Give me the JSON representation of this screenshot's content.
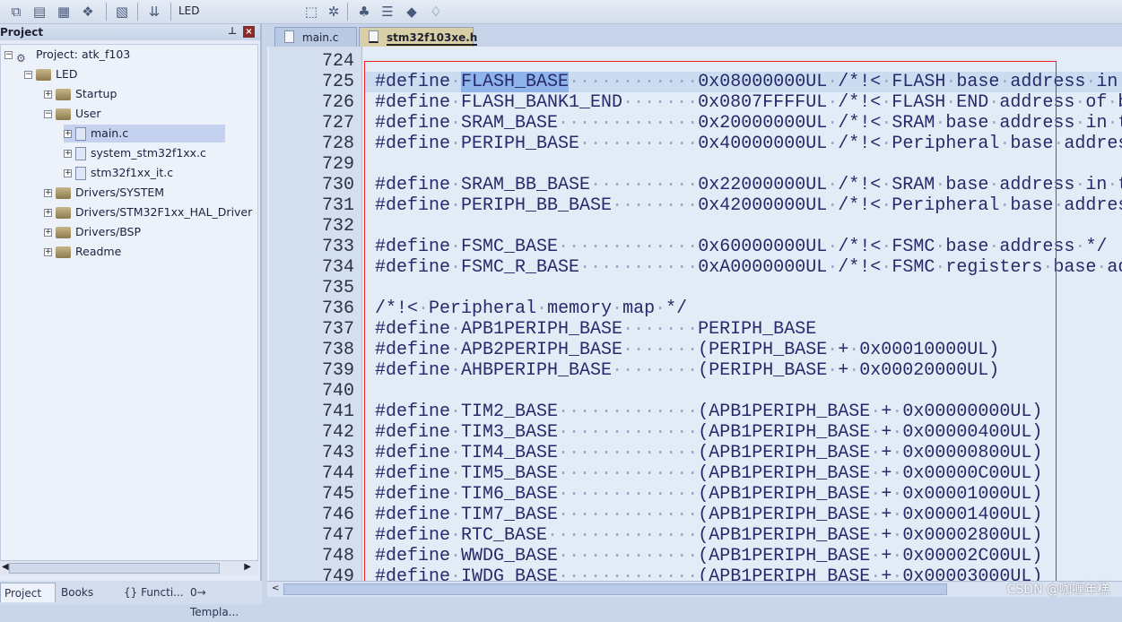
{
  "toolbar": {
    "target": "LED",
    "icons": [
      "translate-icon",
      "build-icon",
      "rebuild-icon",
      "batch-build-icon",
      "stop-build-icon",
      "download-icon",
      "target-options-icon",
      "manage-components-icon",
      "pack-installer-icon",
      "select-device-icon",
      "manage-runtime-icon",
      "books-icon"
    ]
  },
  "project_panel": {
    "title": "Project",
    "tree": [
      {
        "label": "Project: atk_f103",
        "level": 0,
        "expanded": true,
        "type": "project"
      },
      {
        "label": "LED",
        "level": 1,
        "expanded": true,
        "type": "target"
      },
      {
        "label": "Startup",
        "level": 2,
        "expanded": false,
        "type": "folder"
      },
      {
        "label": "User",
        "level": 2,
        "expanded": true,
        "type": "folder"
      },
      {
        "label": "main.c",
        "level": 3,
        "expanded": false,
        "type": "file",
        "selected": true
      },
      {
        "label": "system_stm32f1xx.c",
        "level": 3,
        "expanded": false,
        "type": "file"
      },
      {
        "label": "stm32f1xx_it.c",
        "level": 3,
        "expanded": false,
        "type": "file"
      },
      {
        "label": "Drivers/SYSTEM",
        "level": 2,
        "expanded": false,
        "type": "folder"
      },
      {
        "label": "Drivers/STM32F1xx_HAL_Driver",
        "level": 2,
        "expanded": false,
        "type": "folder"
      },
      {
        "label": "Drivers/BSP",
        "level": 2,
        "expanded": false,
        "type": "folder"
      },
      {
        "label": "Readme",
        "level": 2,
        "expanded": false,
        "type": "folder"
      }
    ],
    "bottom_tabs": [
      "Project",
      "Books",
      "{} Functi...",
      "0→ Templa..."
    ]
  },
  "editor": {
    "tabs": [
      {
        "label": "main.c",
        "active": false
      },
      {
        "label": "stm32f103xe.h",
        "active": true
      }
    ],
    "current_line": 725,
    "selected_word": "FLASH_BASE",
    "lines": [
      {
        "n": "724",
        "text": ""
      },
      {
        "n": "725",
        "text": "#define FLASH_BASE            0x08000000UL /*!< FLASH base address in"
      },
      {
        "n": "726",
        "text": "#define FLASH_BANK1_END       0x0807FFFFUL /*!< FLASH END address of b"
      },
      {
        "n": "727",
        "text": "#define SRAM_BASE             0x20000000UL /*!< SRAM base address in t"
      },
      {
        "n": "728",
        "text": "#define PERIPH_BASE           0x40000000UL /*!< Peripheral base addres"
      },
      {
        "n": "729",
        "text": ""
      },
      {
        "n": "730",
        "text": "#define SRAM_BB_BASE          0x22000000UL /*!< SRAM base address in t"
      },
      {
        "n": "731",
        "text": "#define PERIPH_BB_BASE        0x42000000UL /*!< Peripheral base addres"
      },
      {
        "n": "732",
        "text": ""
      },
      {
        "n": "733",
        "text": "#define FSMC_BASE             0x60000000UL /*!< FSMC base address */"
      },
      {
        "n": "734",
        "text": "#define FSMC_R_BASE           0xA0000000UL /*!< FSMC registers base ad"
      },
      {
        "n": "735",
        "text": ""
      },
      {
        "n": "736",
        "text": "/*!< Peripheral memory map */"
      },
      {
        "n": "737",
        "text": "#define APB1PERIPH_BASE       PERIPH_BASE"
      },
      {
        "n": "738",
        "text": "#define APB2PERIPH_BASE       (PERIPH_BASE + 0x00010000UL)"
      },
      {
        "n": "739",
        "text": "#define AHBPERIPH_BASE        (PERIPH_BASE + 0x00020000UL)"
      },
      {
        "n": "740",
        "text": ""
      },
      {
        "n": "741",
        "text": "#define TIM2_BASE             (APB1PERIPH_BASE + 0x00000000UL)"
      },
      {
        "n": "742",
        "text": "#define TIM3_BASE             (APB1PERIPH_BASE + 0x00000400UL)"
      },
      {
        "n": "743",
        "text": "#define TIM4_BASE             (APB1PERIPH_BASE + 0x00000800UL)"
      },
      {
        "n": "744",
        "text": "#define TIM5_BASE             (APB1PERIPH_BASE + 0x00000C00UL)"
      },
      {
        "n": "745",
        "text": "#define TIM6_BASE             (APB1PERIPH_BASE + 0x00001000UL)"
      },
      {
        "n": "746",
        "text": "#define TIM7_BASE             (APB1PERIPH_BASE + 0x00001400UL)"
      },
      {
        "n": "747",
        "text": "#define RTC_BASE              (APB1PERIPH_BASE + 0x00002800UL)"
      },
      {
        "n": "748",
        "text": "#define WWDG_BASE             (APB1PERIPH_BASE + 0x00002C00UL)"
      },
      {
        "n": "749",
        "text": "#define IWDG_BASE             (APB1PERIPH_BASE + 0x00003000UL)"
      }
    ]
  },
  "watermark": "CSDN @咖喱年糕",
  "colors": {
    "highlight_box": "#e22222",
    "current_line": "#cbdcf1",
    "selection": "#8fb4ea"
  }
}
